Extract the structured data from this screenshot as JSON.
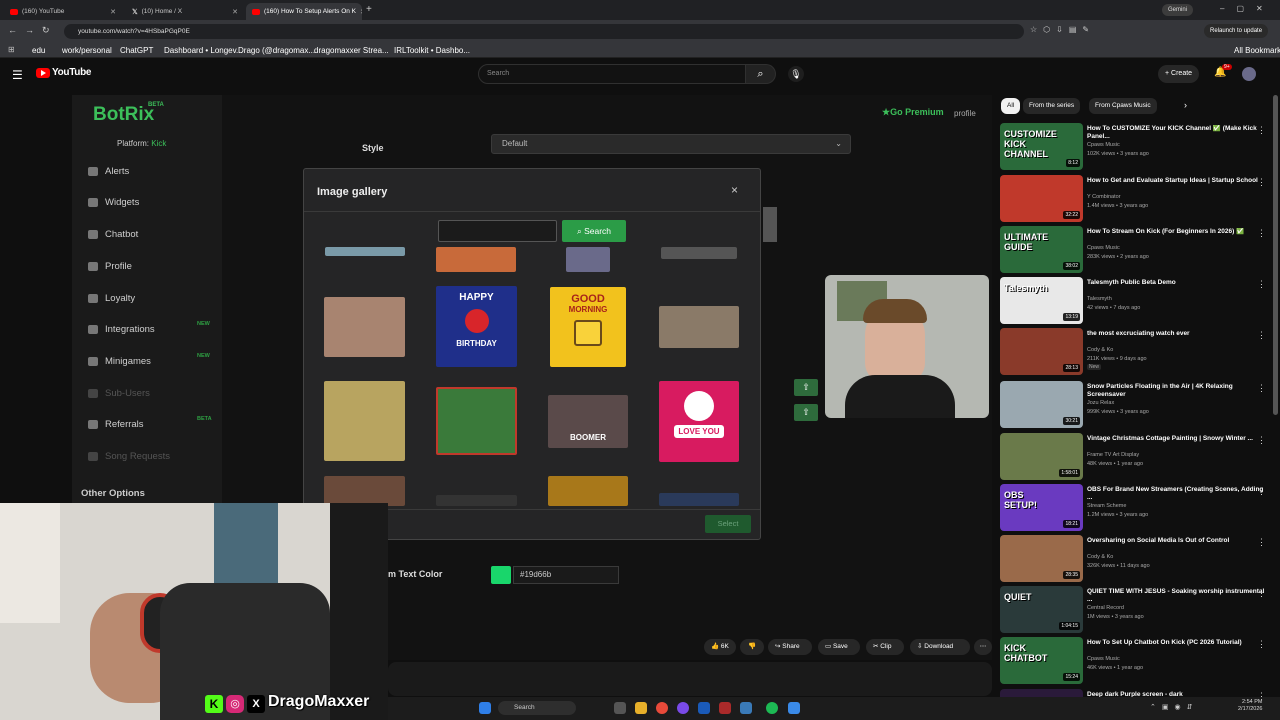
{
  "browser": {
    "tabs": [
      {
        "label": "(160) YouTube"
      },
      {
        "label": "(10) Home / X"
      },
      {
        "label": "(160) How To Setup Alerts On K"
      }
    ],
    "profile_badge": "Gemini",
    "url": "youtube.com/watch?v=4HSbaPGqP0E",
    "relaunch": "Relaunch to update",
    "bookmarks": [
      "edu",
      "work/personal",
      "ChatGPT",
      "Dashboard • Longev...",
      "Drago (@dragomax...",
      "dragomaxxer Strea...",
      "IRLToolkit • Dashbo..."
    ],
    "all_bookmarks": "All Bookmarks"
  },
  "youtube": {
    "logo": "YouTube",
    "search_placeholder": "Search",
    "create": "Create",
    "notif_count": "9+"
  },
  "botrix": {
    "logo": "BotRix",
    "beta": "BETA",
    "platform_label": "Platform: ",
    "platform_value": "Kick",
    "go_premium": "Go Premium",
    "profile": "profile",
    "style_label": "Style",
    "style_value": "Default",
    "sidebar": [
      {
        "label": "Alerts"
      },
      {
        "label": "Widgets"
      },
      {
        "label": "Chatbot"
      },
      {
        "label": "Profile"
      },
      {
        "label": "Loyalty"
      },
      {
        "label": "Integrations",
        "badge": "NEW"
      },
      {
        "label": "Minigames",
        "badge": "NEW"
      },
      {
        "label": "Sub-Users"
      },
      {
        "label": "Referrals",
        "badge": "BETA"
      },
      {
        "label": "Song Requests"
      }
    ],
    "other_options": "Other Options",
    "text_color_label": "m Text Color",
    "text_color_value": "#19d66b"
  },
  "modal": {
    "title": "Image gallery",
    "close": "×",
    "search_button": "Search",
    "select_button": "Select",
    "gif_captions": {
      "happy": "HAPPY",
      "birthday": "BIRTHDAY",
      "good": "GOOD",
      "morning": "MORNING",
      "love_you": "LOVE YOU",
      "boomer": "BOOMER"
    }
  },
  "webcam_overlay": {
    "handle": "DragoMaxxer"
  },
  "right_column": {
    "chips": [
      "All",
      "From the series",
      "From Cpaws Music"
    ],
    "videos": [
      {
        "title": "How To CUSTOMIZE Your KICK Channel ✅ (Make Kick Panel...",
        "channel": "Cpaws Music",
        "meta": "102K views • 3 years ago",
        "duration": "8:12",
        "thumb_text": "CUSTOMIZE KICK CHANNEL",
        "color": "#2a6a3a"
      },
      {
        "title": "How to Get and Evaluate Startup Ideas | Startup School",
        "channel": "Y Combinator",
        "meta": "1.4M views • 3 years ago",
        "duration": "32:22",
        "thumb_text": "",
        "color": "#c0392b"
      },
      {
        "title": "How To Stream On Kick (For Beginners In 2026) ✅",
        "channel": "Cpaws Music",
        "meta": "283K views • 2 years ago",
        "duration": "38:02",
        "thumb_text": "ULTIMATE GUIDE",
        "color": "#2a6a3a"
      },
      {
        "title": "Talesmyth Public Beta Demo",
        "channel": "Talesmyth",
        "meta": "42 views • 7 days ago",
        "duration": "13:19",
        "thumb_text": "Talesmyth",
        "color": "#e8e8e8"
      },
      {
        "title": "the most excruciating watch ever",
        "channel": "Cody & Ko",
        "meta": "211K views • 9 days ago",
        "duration": "28:13",
        "thumb_text": "",
        "color": "#8a3a2a",
        "new": "New"
      },
      {
        "title": "Snow Particles Floating in the Air | 4K Relaxing Screensaver",
        "channel": "Jozu Relax",
        "meta": "999K views • 3 years ago",
        "duration": "30:21",
        "thumb_text": "",
        "color": "#9aa8b0"
      },
      {
        "title": "Vintage Christmas Cottage Painting | Snowy Winter ...",
        "channel": "Frame TV Art Display",
        "meta": "48K views • 1 year ago",
        "duration": "1:58:01",
        "thumb_text": "",
        "color": "#6a7a4a"
      },
      {
        "title": "OBS For Brand New Streamers (Creating Scenes, Adding ...",
        "channel": "Stream Scheme",
        "meta": "1.2M views • 3 years ago",
        "duration": "18:21",
        "thumb_text": "OBS SETUP!",
        "color": "#6a3ac0"
      },
      {
        "title": "Oversharing on Social Media Is Out of Control",
        "channel": "Cody & Ko",
        "meta": "326K views • 11 days ago",
        "duration": "28:35",
        "thumb_text": "",
        "color": "#9a6a4a"
      },
      {
        "title": "QUIET TIME WITH JESUS - Soaking worship instrumental ...",
        "channel": "Central Record",
        "meta": "1M views • 3 years ago",
        "duration": "1:04:15",
        "thumb_text": "QUIET",
        "color": "#2a3a3a"
      },
      {
        "title": "How To Set Up Chatbot On Kick (PC 2026 Tutorial)",
        "channel": "Cpaws Music",
        "meta": "46K views • 1 year ago",
        "duration": "15:24",
        "thumb_text": "KICK CHATBOT",
        "color": "#2a6a3a"
      },
      {
        "title": "Deep dark Purple screen - dark",
        "channel": "",
        "meta": "",
        "duration": "",
        "thumb_text": "",
        "color": "#2a1a3a"
      }
    ]
  },
  "actions": {
    "like_count": "6K",
    "share": "Share",
    "save": "Save",
    "clip": "Clip",
    "download": "Download"
  },
  "taskbar": {
    "search": "Search",
    "time": "2:54 PM",
    "date": "2/17/2026"
  }
}
